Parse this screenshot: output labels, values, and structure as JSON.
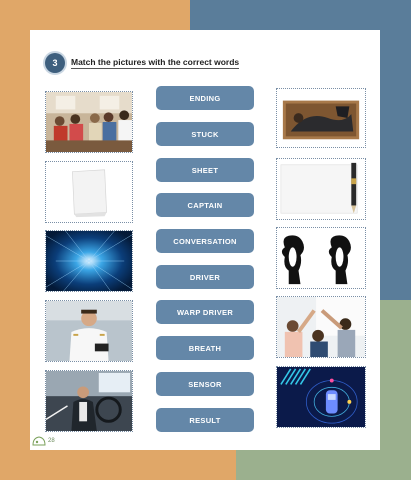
{
  "exercise": {
    "number": "3",
    "instruction": "Match the pictures with the correct words"
  },
  "words": [
    "ENDING",
    "STUCK",
    "SHEET",
    "CAPTAIN",
    "CONVERSATION",
    "DRIVER",
    "WARP DRIVER",
    "BREATH",
    "SENSOR",
    "RESULT"
  ],
  "footer": {
    "page": "28"
  },
  "colors": {
    "button": "#6487a8",
    "badge": "#3e5f7e",
    "bg_orange": "#e0a768",
    "bg_blue": "#5a7d9a",
    "bg_green": "#9bb08e"
  }
}
